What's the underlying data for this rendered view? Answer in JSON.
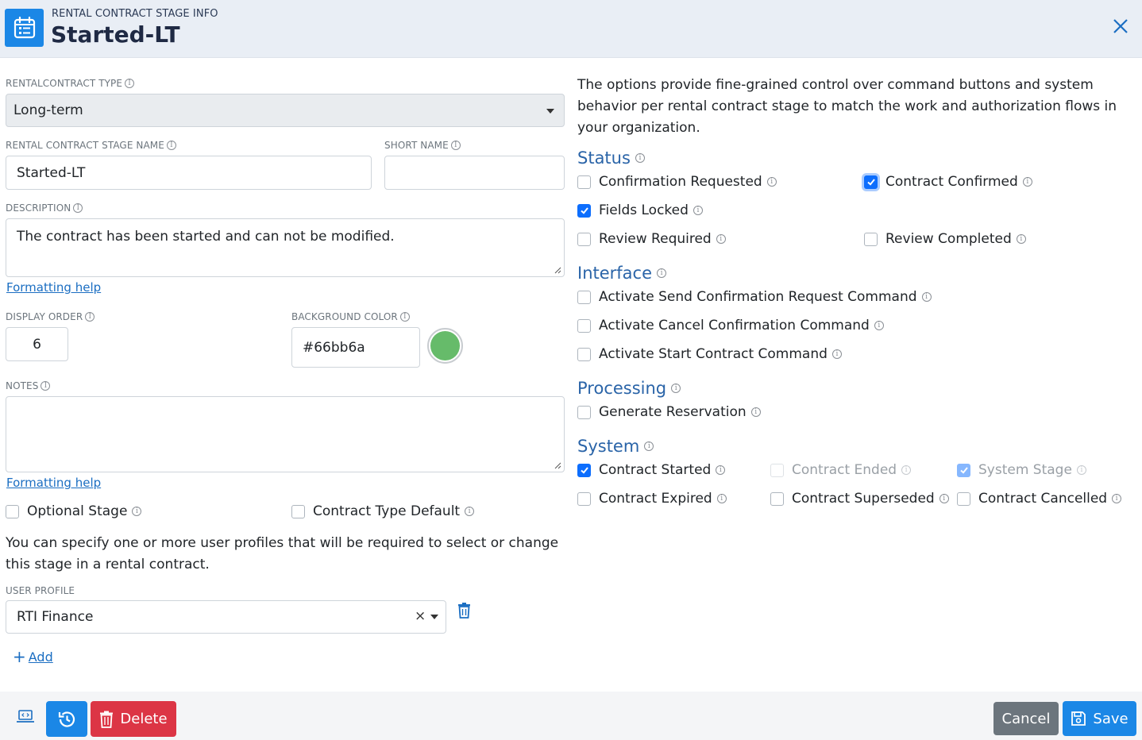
{
  "header": {
    "kicker": "RENTAL CONTRACT STAGE INFO",
    "title": "Started-LT"
  },
  "form": {
    "contract_type_label": "RENTALCONTRACT TYPE",
    "contract_type_value": "Long-term",
    "stage_name_label": "RENTAL CONTRACT STAGE NAME",
    "stage_name_value": "Started-LT",
    "short_name_label": "SHORT NAME",
    "short_name_value": "",
    "description_label": "DESCRIPTION",
    "description_value": "The contract has been started and can not be modified.",
    "formatting_help": "Formatting help",
    "display_order_label": "DISPLAY ORDER",
    "display_order_value": "6",
    "bg_color_label": "BACKGROUND COLOR",
    "bg_color_value": "#66bb6a",
    "notes_label": "NOTES",
    "notes_value": "",
    "optional_stage": {
      "label": "Optional Stage",
      "checked": false
    },
    "contract_type_default": {
      "label": "Contract Type Default",
      "checked": false
    },
    "profiles_text": "You can specify one or more user profiles that will be required to select or change this stage in a rental contract.",
    "user_profile_label": "USER PROFILE",
    "user_profile_value": "RTI Finance",
    "add_label": "Add"
  },
  "options": {
    "intro": "The options provide fine-grained control over command buttons and system behavior per rental contract stage to match the work and authorization flows in your organization.",
    "status_title": "Status",
    "status": {
      "confirmation_requested": {
        "label": "Confirmation Requested",
        "checked": false
      },
      "contract_confirmed": {
        "label": "Contract Confirmed",
        "checked": true
      },
      "fields_locked": {
        "label": "Fields Locked",
        "checked": true
      },
      "review_required": {
        "label": "Review Required",
        "checked": false
      },
      "review_completed": {
        "label": "Review Completed",
        "checked": false
      }
    },
    "interface_title": "Interface",
    "interface": {
      "send_confirmation": {
        "label": "Activate Send Confirmation Request Command",
        "checked": false
      },
      "cancel_confirmation": {
        "label": "Activate Cancel Confirmation Command",
        "checked": false
      },
      "start_contract": {
        "label": "Activate Start Contract Command",
        "checked": false
      }
    },
    "processing_title": "Processing",
    "processing": {
      "generate_reservation": {
        "label": "Generate Reservation",
        "checked": false
      }
    },
    "system_title": "System",
    "system": {
      "contract_started": {
        "label": "Contract Started",
        "checked": true
      },
      "contract_ended": {
        "label": "Contract Ended",
        "checked": false
      },
      "system_stage": {
        "label": "System Stage",
        "checked": true
      },
      "contract_expired": {
        "label": "Contract Expired",
        "checked": false
      },
      "contract_superseded": {
        "label": "Contract Superseded",
        "checked": false
      },
      "contract_cancelled": {
        "label": "Contract Cancelled",
        "checked": false
      }
    }
  },
  "footer": {
    "delete_label": "Delete",
    "cancel_label": "Cancel",
    "save_label": "Save"
  },
  "colors": {
    "primary": "#1b87e6",
    "danger": "#dc3545",
    "secondary": "#6c757d",
    "swatch": "#66bb6a"
  }
}
